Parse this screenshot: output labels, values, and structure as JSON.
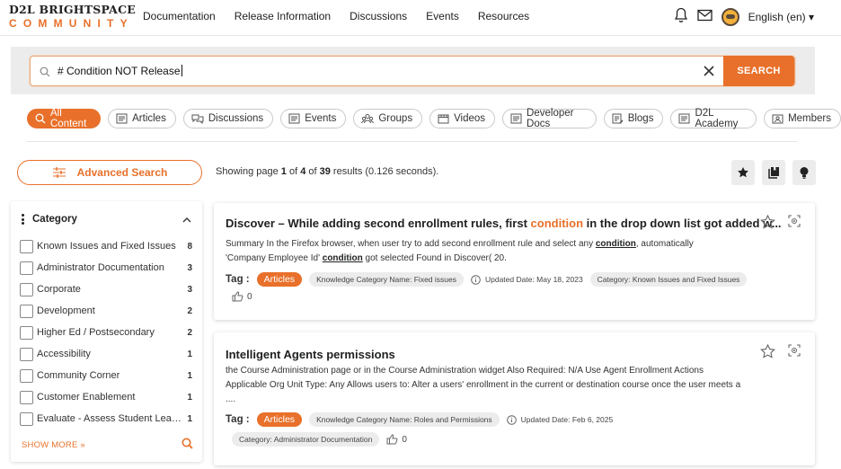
{
  "brand": {
    "line1": "D2L BRIGHTSPACE",
    "line2": "COMMUNITY"
  },
  "nav": [
    "Documentation",
    "Release Information",
    "Discussions",
    "Events",
    "Resources"
  ],
  "language": "English (en)",
  "search": {
    "query": "# Condition NOT Release",
    "button": "SEARCH"
  },
  "filters": [
    {
      "label": "All Content",
      "icon": "search-icon",
      "active": true
    },
    {
      "label": "Articles",
      "icon": "article-icon"
    },
    {
      "label": "Discussions",
      "icon": "discussion-icon"
    },
    {
      "label": "Events",
      "icon": "event-icon"
    },
    {
      "label": "Groups",
      "icon": "groups-icon"
    },
    {
      "label": "Videos",
      "icon": "video-icon"
    },
    {
      "label": "Developer Docs",
      "icon": "developer-docs-icon"
    },
    {
      "label": "Blogs",
      "icon": "blog-icon"
    },
    {
      "label": "D2L Academy",
      "icon": "academy-icon"
    },
    {
      "label": "Members",
      "icon": "members-icon"
    }
  ],
  "advanced_search": "Advanced Search",
  "results": {
    "prefix": "Showing page ",
    "page": "1",
    "of": " of ",
    "pages": "4",
    "of2": " of ",
    "total": "39",
    "suffix": " results (0.126 seconds)."
  },
  "sidebar": {
    "title": "Category",
    "items": [
      {
        "label": "Known Issues and Fixed Issues",
        "count": "8"
      },
      {
        "label": "Administrator Documentation",
        "count": "3"
      },
      {
        "label": "Corporate",
        "count": "3"
      },
      {
        "label": "Development",
        "count": "2"
      },
      {
        "label": "Higher Ed / Postsecondary",
        "count": "2"
      },
      {
        "label": "Accessibility",
        "count": "1"
      },
      {
        "label": "Community Corner",
        "count": "1"
      },
      {
        "label": "Customer Enablement",
        "count": "1"
      },
      {
        "label": "Evaluate - Assess Student Lear...",
        "count": "1"
      }
    ],
    "show_more": "SHOW MORE »"
  },
  "cards": [
    {
      "title_pre": "Discover – While adding second enrollment rules, first ",
      "title_hl": "condition",
      "title_post": " in the drop down list got added w...",
      "desc1": "Summary In the Firefox browser, when user try to add second enrollment rule and select any ",
      "desc1_b": "condition",
      "desc1_post": ", automatically",
      "desc2": "'Company Employee Id' ",
      "desc2_b": "condition",
      "desc2_post": " got selected Found in Discover( 20.",
      "tag_label": "Tag :",
      "tag": "Articles",
      "knowledge": "Knowledge Category Name: Fixed issues",
      "updated": "Updated Date: May 18, 2023",
      "category": "Category: Known Issues and Fixed Issues",
      "likes": "0"
    },
    {
      "title": "Intelligent Agents permissions",
      "desc": "the Course Administration page or in the Course Administration widget Also Required: N/A Use Agent Enrollment Actions Applicable Org Unit Type: Any Allows users to: Alter a users' enrollment in the current or destination course once the user meets a ....",
      "tag_label": "Tag :",
      "tag": "Articles",
      "knowledge": "Knowledge Category Name: Roles and Permissions",
      "updated": "Updated Date: Feb 6, 2025",
      "category": "Category: Administrator Documentation",
      "likes": "0"
    }
  ],
  "colors": {
    "accent": "#e8702a",
    "band": "#ececec"
  }
}
